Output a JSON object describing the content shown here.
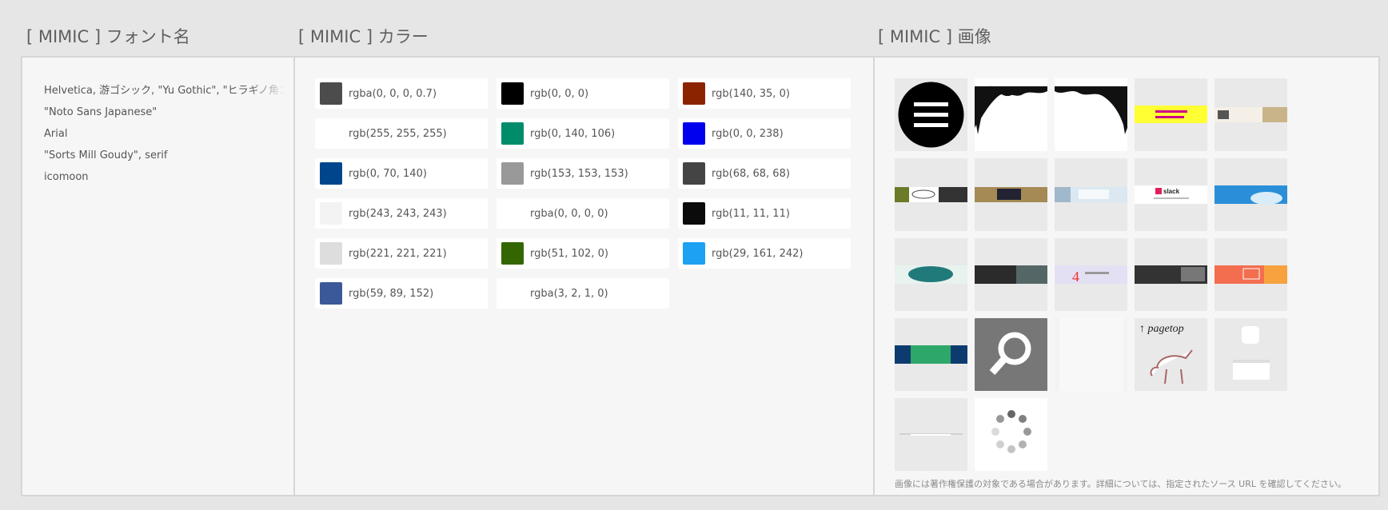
{
  "sections": {
    "fonts_title": "[ MIMIC ] フォント名",
    "colors_title": "[ MIMIC ] カラー",
    "images_title": "[ MIMIC ] 画像"
  },
  "fonts": [
    "Helvetica, 游ゴシック, \"Yu Gothic\", \"ヒラギノ角ゴ",
    "\"Noto Sans Japanese\"",
    "Arial",
    "\"Sorts Mill Goudy\", serif",
    "icomoon"
  ],
  "colors": [
    {
      "label": "rgba(0, 0, 0, 0.7)",
      "swatch": "rgba(0, 0, 0, 0.7)"
    },
    {
      "label": "rgb(0, 0, 0)",
      "swatch": "rgb(0, 0, 0)"
    },
    {
      "label": "rgb(140, 35, 0)",
      "swatch": "rgb(140, 35, 0)"
    },
    {
      "label": "rgb(255, 255, 255)",
      "swatch": "rgb(255, 255, 255)"
    },
    {
      "label": "rgb(0, 140, 106)",
      "swatch": "rgb(0, 140, 106)"
    },
    {
      "label": "rgb(0, 0, 238)",
      "swatch": "rgb(0, 0, 238)"
    },
    {
      "label": "rgb(0, 70, 140)",
      "swatch": "rgb(0, 70, 140)"
    },
    {
      "label": "rgb(153, 153, 153)",
      "swatch": "rgb(153, 153, 153)"
    },
    {
      "label": "rgb(68, 68, 68)",
      "swatch": "rgb(68, 68, 68)"
    },
    {
      "label": "rgb(243, 243, 243)",
      "swatch": "rgb(243, 243, 243)"
    },
    {
      "label": "rgba(0, 0, 0, 0)",
      "swatch": "rgba(0, 0, 0, 0)"
    },
    {
      "label": "rgb(11, 11, 11)",
      "swatch": "rgb(11, 11, 11)"
    },
    {
      "label": "rgb(221, 221, 221)",
      "swatch": "rgb(221, 221, 221)"
    },
    {
      "label": "rgb(51, 102, 0)",
      "swatch": "rgb(51, 102, 0)"
    },
    {
      "label": "rgb(29, 161, 242)",
      "swatch": "rgb(29, 161, 242)"
    },
    {
      "label": "rgb(59, 89, 152)",
      "swatch": "rgb(59, 89, 152)"
    },
    {
      "label": "rgba(3, 2, 1, 0)",
      "swatch": "rgba(3, 2, 1, 0)"
    }
  ],
  "images": [
    {
      "name": "hamburger-menu-icon"
    },
    {
      "name": "tree-silhouette-left-image"
    },
    {
      "name": "tree-silhouette-right-image"
    },
    {
      "name": "animation-design-banner-image",
      "text": "アニメーションでアンダーライン"
    },
    {
      "name": "cafe-banner-image"
    },
    {
      "name": "sugar-logo-banner-image"
    },
    {
      "name": "chalkboard-banner-image"
    },
    {
      "name": "office-banner-image"
    },
    {
      "name": "slack-banner-image",
      "text": "slack"
    },
    {
      "name": "sky-banner-image"
    },
    {
      "name": "teal-badge-banner-image"
    },
    {
      "name": "dark-photo-banner-image"
    },
    {
      "name": "number-four-banner-image",
      "text": "4"
    },
    {
      "name": "laptop-banner-image"
    },
    {
      "name": "orange-banner-image"
    },
    {
      "name": "green-blue-banner-image"
    },
    {
      "name": "search-magnifier-icon"
    },
    {
      "name": "texture-image"
    },
    {
      "name": "pagetop-goat-image",
      "text": "↑ pagetop"
    },
    {
      "name": "button-shapes-image"
    },
    {
      "name": "thin-line-image"
    },
    {
      "name": "loading-spinner-icon"
    }
  ],
  "footnote": "画像には著作権保護の対象である場合があります。詳細については、指定されたソース URL を確認してください。"
}
